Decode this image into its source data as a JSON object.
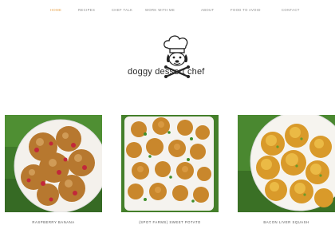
{
  "nav": {
    "items": [
      {
        "label": "HOME",
        "active": true
      },
      {
        "label": "RECIPES",
        "active": false
      },
      {
        "label": "CHEF TALK",
        "active": false
      },
      {
        "label": "WORK WITH ME",
        "active": false
      },
      {
        "label": "ABOUT",
        "active": false
      },
      {
        "label": "FOOD TO AVOID",
        "active": false
      },
      {
        "label": "CONTACT",
        "active": false
      }
    ],
    "accent_color": "#e8a24a"
  },
  "logo": {
    "text": "doggy dessert chef",
    "icon": "chef-hat-dog-icon"
  },
  "posts": [
    {
      "caption": "RASPBERRY BANANA",
      "image": "raspberry-banana-treats-image"
    },
    {
      "caption": "(SPOT FARMS) SWEET POTATO",
      "image": "sweet-potato-treats-image"
    },
    {
      "caption": "BACON LIVER SQUASH",
      "image": "bacon-liver-squash-treats-image"
    }
  ]
}
